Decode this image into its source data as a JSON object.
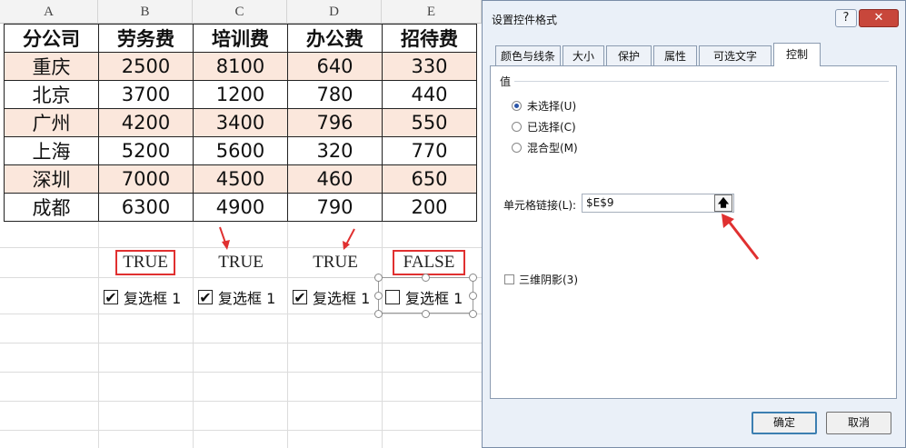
{
  "sheet": {
    "columns": [
      "A",
      "B",
      "C",
      "D",
      "E"
    ],
    "header_row": [
      "分公司",
      "劳务费",
      "培训费",
      "办公费",
      "招待费"
    ],
    "rows": [
      [
        "重庆",
        "2500",
        "8100",
        "640",
        "330"
      ],
      [
        "北京",
        "3700",
        "1200",
        "780",
        "440"
      ],
      [
        "广州",
        "4200",
        "3400",
        "796",
        "550"
      ],
      [
        "上海",
        "5200",
        "5600",
        "320",
        "770"
      ],
      [
        "深圳",
        "7000",
        "4500",
        "460",
        "650"
      ],
      [
        "成都",
        "6300",
        "4900",
        "790",
        "200"
      ]
    ],
    "bools": [
      "TRUE",
      "TRUE",
      "TRUE",
      "FALSE"
    ],
    "checkboxes": [
      {
        "label": "复选框 1",
        "checked": true
      },
      {
        "label": "复选框 1",
        "checked": true
      },
      {
        "label": "复选框 1",
        "checked": true
      },
      {
        "label": "复选框 1",
        "checked": false
      }
    ],
    "row_band_color": "#fbe7dc"
  },
  "dialog": {
    "title": "设置控件格式",
    "help_label": "?",
    "close_label": "✕",
    "tabs": [
      "颜色与线条",
      "大小",
      "保护",
      "属性",
      "可选文字",
      "控制"
    ],
    "active_tab": "控制",
    "group_title": "值",
    "radios": [
      {
        "label": "未选择(U)",
        "selected": true
      },
      {
        "label": "已选择(C)",
        "selected": false
      },
      {
        "label": "混合型(M)",
        "selected": false
      }
    ],
    "cell_link_label": "单元格链接(L):",
    "cell_link_value": "$E$9",
    "shade_label": "三维阴影(3)",
    "ok_label": "确定",
    "cancel_label": "取消"
  },
  "colors": {
    "annotation_red": "#e03030",
    "dialog_bg": "#eaf0f8",
    "close_red": "#c8473b"
  }
}
